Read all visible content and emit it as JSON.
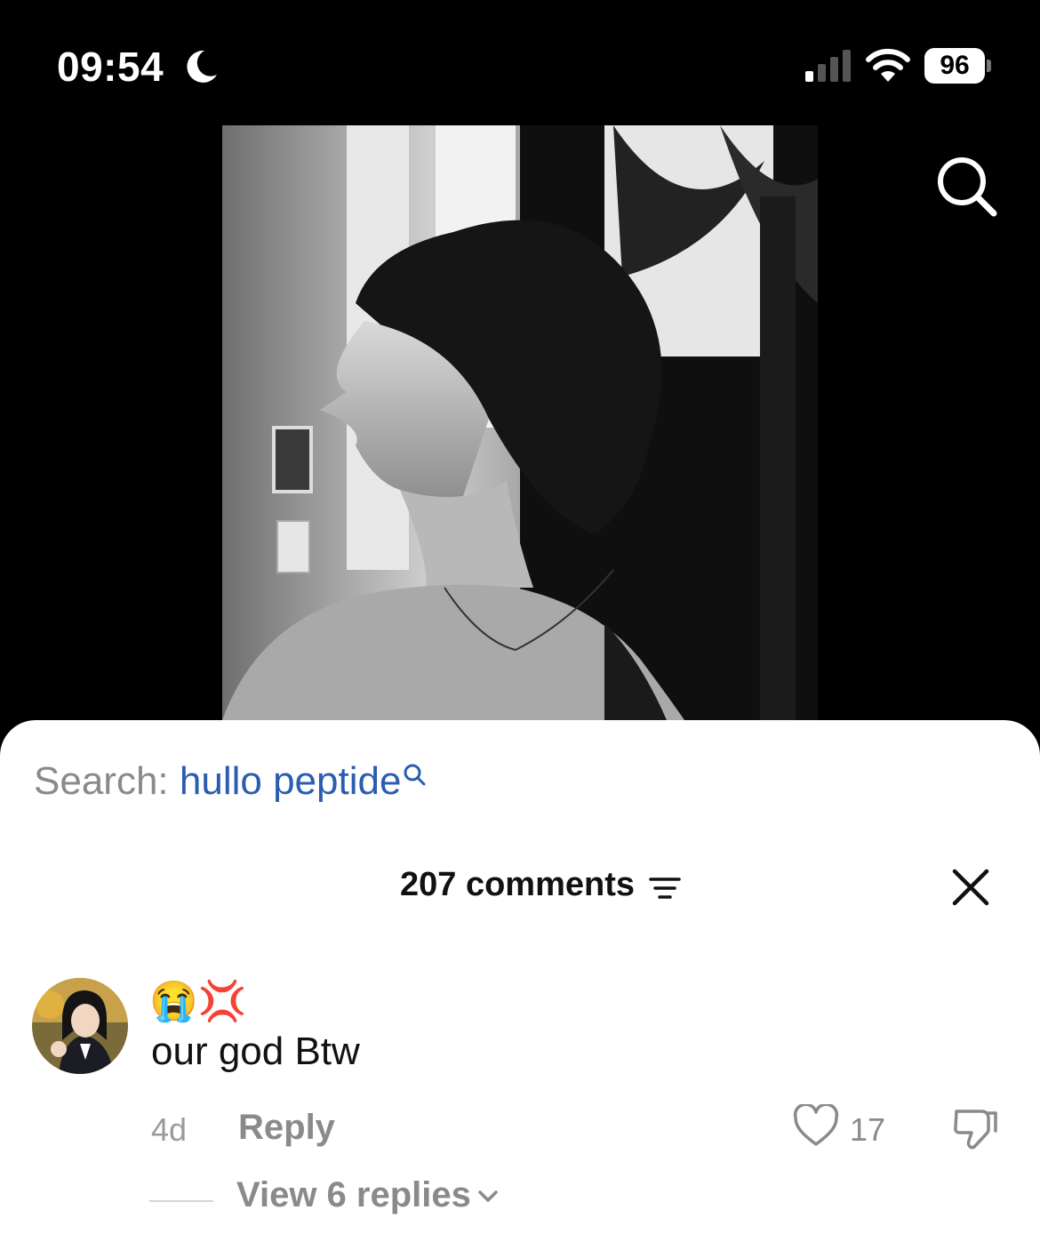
{
  "status": {
    "time": "09:54",
    "battery": "96"
  },
  "search": {
    "prefix": "Search: ",
    "term": "hullo peptide"
  },
  "comments": {
    "title": "207 comments",
    "items": [
      {
        "emojis": "😭💢",
        "text": "our god Btw",
        "age": "4d",
        "reply_label": "Reply",
        "likes": "17",
        "view_replies": "View 6 replies"
      }
    ]
  }
}
